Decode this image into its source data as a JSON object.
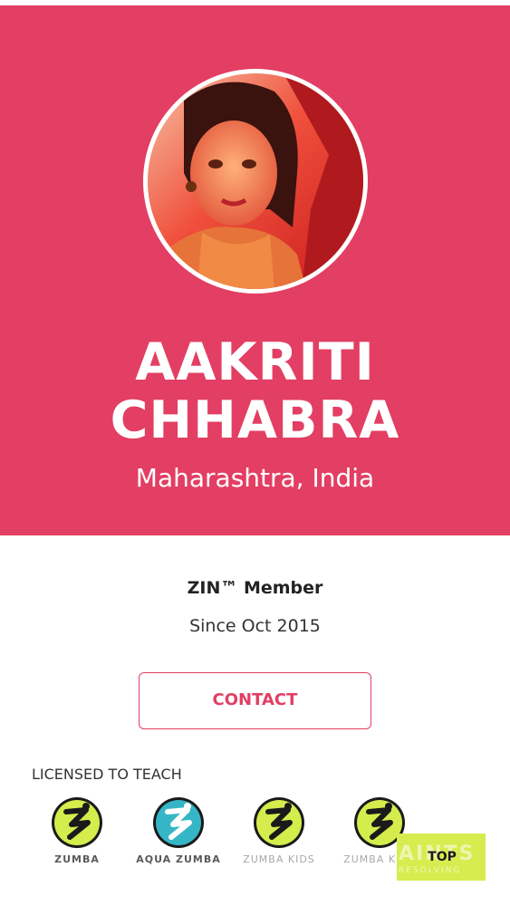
{
  "profile": {
    "name_line1": "AAKRITI",
    "name_line2": "CHHABRA",
    "location": "Maharashtra, India",
    "avatar_alt": "Profile photo of Aakriti Chhabra"
  },
  "membership": {
    "title": "ZIN™ Member",
    "since": "Since Oct 2015"
  },
  "actions": {
    "contact_label": "CONTACT",
    "top_label": "TOP",
    "overlay_watermark": "AINTS",
    "overlay_watermark_sub": "RESOLVING"
  },
  "licensed": {
    "heading": "LICENSED TO TEACH",
    "programs": [
      {
        "label": "ZUMBA",
        "icon": "zumba-logo-icon",
        "color": "#d4ec4c"
      },
      {
        "label": "AQUA ZUMBA",
        "icon": "aqua-zumba-logo-icon",
        "color": "#35b6c6"
      },
      {
        "label": "ZUMBA KIDS",
        "icon": "zumba-kids-logo-icon",
        "color": "#d4ec4c"
      },
      {
        "label": "ZUMBA KIDS",
        "icon": "zumba-kids-logo-icon",
        "color": "#d4ec4c"
      }
    ]
  },
  "colors": {
    "brand_pink": "#e33e63",
    "zumba_lime": "#d4ec4c",
    "aqua_teal": "#35b6c6"
  }
}
